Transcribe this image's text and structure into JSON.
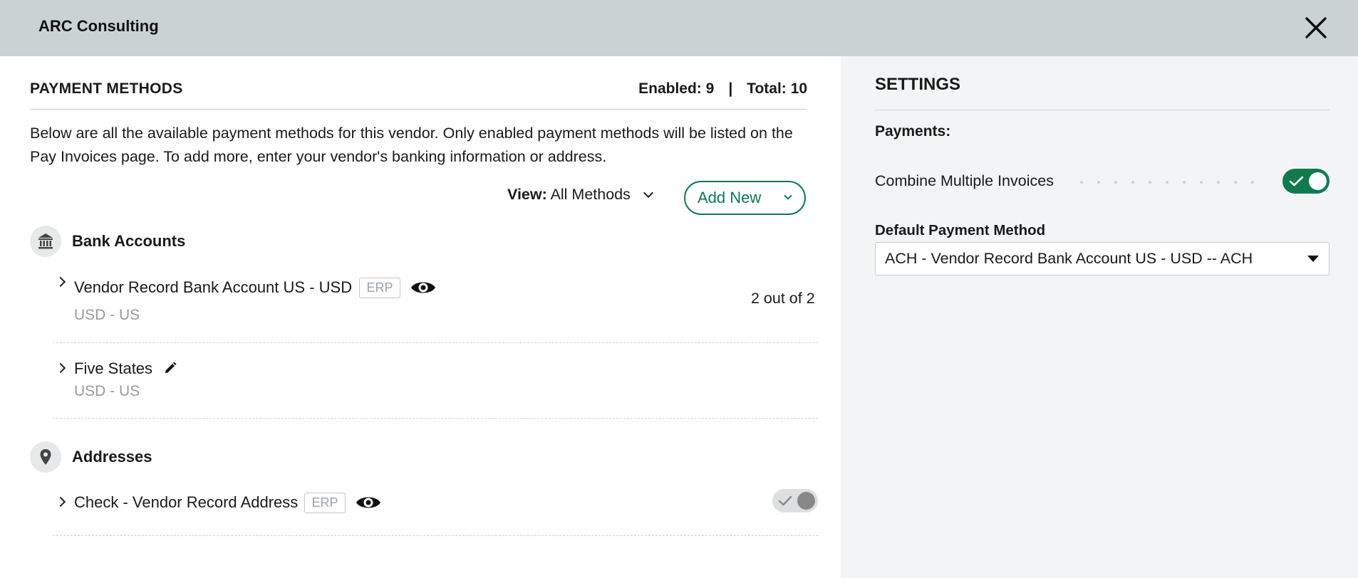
{
  "window": {
    "title": "ARC Consulting",
    "close_icon": "close-icon"
  },
  "payment_methods": {
    "title": "PAYMENT METHODS",
    "enabled_label": "Enabled: 9",
    "separator": "|",
    "total_label": "Total: 10",
    "description": "Below are all the available payment methods for this vendor. Only enabled payment methods will be listed on the Pay Invoices page. To add more, enter your vendor's banking information or address.",
    "view_label": "View:",
    "view_value": "All Methods",
    "add_new_label": "Add New",
    "bank_accounts": {
      "title": "Bank Accounts",
      "icon": "bank-icon",
      "items": [
        {
          "name": "Vendor Record Bank Account US - USD",
          "badge": "ERP",
          "subtitle": "USD - US",
          "count": "2 out of 2",
          "icon": "eye-icon"
        },
        {
          "name": "Five States",
          "subtitle": "USD - US",
          "icon": "pencil-icon"
        }
      ]
    },
    "addresses": {
      "title": "Addresses",
      "icon": "location-pin-icon",
      "items": [
        {
          "name": "Check - Vendor Record Address",
          "badge": "ERP",
          "icon": "eye-icon",
          "enabled": false
        }
      ]
    }
  },
  "settings": {
    "title": "SETTINGS",
    "payments_label": "Payments:",
    "combine_label": "Combine Multiple Invoices",
    "combine_enabled": true,
    "default_method_label": "Default Payment Method",
    "default_method_value": "ACH - Vendor Record Bank Account US - USD -- ACH"
  },
  "colors": {
    "accent": "#0e7a4e",
    "header_bg": "#c9d3d4",
    "panel_bg": "#f2f4f5"
  }
}
